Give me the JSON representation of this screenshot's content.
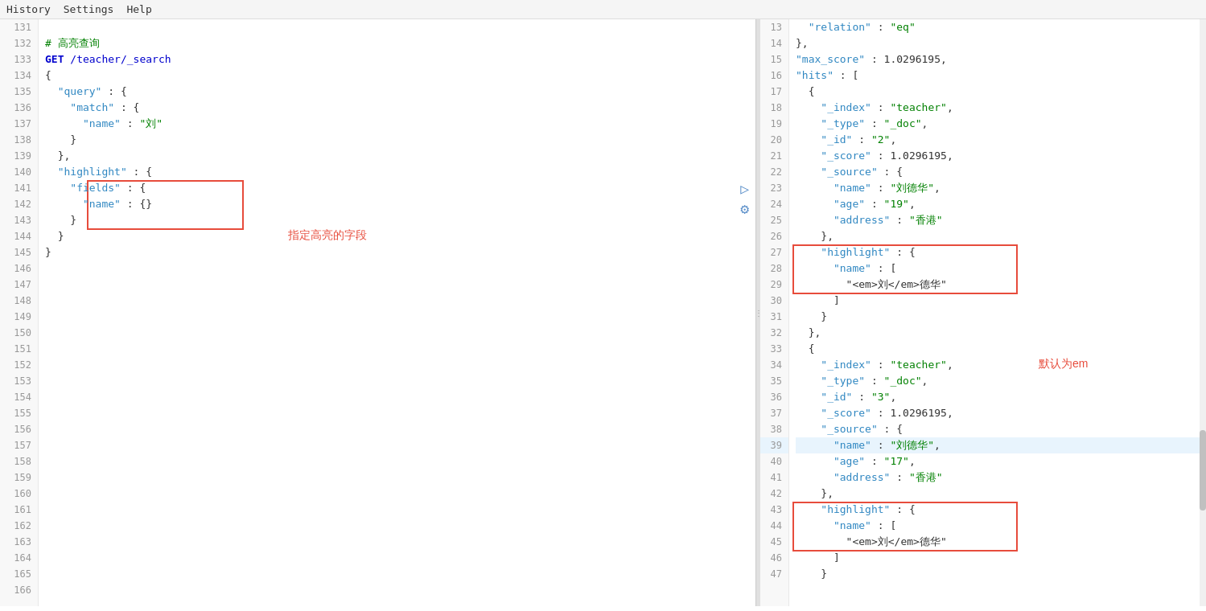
{
  "menu": {
    "items": [
      "History",
      "Settings",
      "Help"
    ]
  },
  "left_panel": {
    "lines": [
      {
        "num": 131,
        "content": "",
        "indent": 0
      },
      {
        "num": 132,
        "content": "# 高亮查询",
        "type": "comment"
      },
      {
        "num": 133,
        "content": "GET /teacher/_search",
        "type": "http"
      },
      {
        "num": 134,
        "content": "{",
        "fold": true
      },
      {
        "num": 135,
        "content": "  \"query\": {",
        "fold": true
      },
      {
        "num": 136,
        "content": "    \"match\": {",
        "fold": true
      },
      {
        "num": 137,
        "content": "      \"name\": \"刘\""
      },
      {
        "num": 138,
        "content": "    }"
      },
      {
        "num": 139,
        "content": "  },"
      },
      {
        "num": 140,
        "content": "  \"highlight\": {",
        "fold": true
      },
      {
        "num": 141,
        "content": "    \"fields\": {",
        "fold": true
      },
      {
        "num": 142,
        "content": "      \"name\": {}"
      },
      {
        "num": 143,
        "content": "    }"
      },
      {
        "num": 144,
        "content": "  }"
      },
      {
        "num": 145,
        "content": "}",
        "fold": true
      },
      {
        "num": 146,
        "content": ""
      },
      {
        "num": 147,
        "content": ""
      },
      {
        "num": 148,
        "content": ""
      },
      {
        "num": 149,
        "content": ""
      },
      {
        "num": 150,
        "content": ""
      },
      {
        "num": 151,
        "content": ""
      },
      {
        "num": 152,
        "content": ""
      },
      {
        "num": 153,
        "content": ""
      },
      {
        "num": 154,
        "content": ""
      },
      {
        "num": 155,
        "content": ""
      },
      {
        "num": 156,
        "content": ""
      },
      {
        "num": 157,
        "content": ""
      },
      {
        "num": 158,
        "content": ""
      },
      {
        "num": 159,
        "content": ""
      },
      {
        "num": 160,
        "content": ""
      },
      {
        "num": 161,
        "content": ""
      },
      {
        "num": 162,
        "content": ""
      },
      {
        "num": 163,
        "content": ""
      },
      {
        "num": 164,
        "content": ""
      },
      {
        "num": 165,
        "content": ""
      },
      {
        "num": 166,
        "content": ""
      }
    ],
    "annotation1": "指定高亮的字段",
    "annotation2": "默认为em"
  },
  "right_panel": {
    "lines": [
      {
        "num": 13,
        "content": "  \"relation\" : \"eq\""
      },
      {
        "num": 14,
        "content": "},",
        "fold": true
      },
      {
        "num": 15,
        "content": "\"max_score\" : 1.0296195,"
      },
      {
        "num": 16,
        "content": "\"hits\" : [",
        "fold": true
      },
      {
        "num": 17,
        "content": "  {",
        "fold": true
      },
      {
        "num": 18,
        "content": "    \"_index\" : \"teacher\","
      },
      {
        "num": 19,
        "content": "    \"_type\" : \"_doc\","
      },
      {
        "num": 20,
        "content": "    \"_id\" : \"2\","
      },
      {
        "num": 21,
        "content": "    \"_score\" : 1.0296195,"
      },
      {
        "num": 22,
        "content": "    \"_source\" : {",
        "fold": true
      },
      {
        "num": 23,
        "content": "      \"name\" : \"刘德华\","
      },
      {
        "num": 24,
        "content": "      \"age\" : \"19\","
      },
      {
        "num": 25,
        "content": "      \"address\" : \"香港\""
      },
      {
        "num": 26,
        "content": "    },"
      },
      {
        "num": 27,
        "content": "    \"highlight\" : {",
        "fold": true
      },
      {
        "num": 28,
        "content": "      \"name\" : ["
      },
      {
        "num": 29,
        "content": "        \"<em>刘</em>德华\""
      },
      {
        "num": 30,
        "content": "      ]"
      },
      {
        "num": 31,
        "content": "    }"
      },
      {
        "num": 32,
        "content": "  },"
      },
      {
        "num": 33,
        "content": "  {",
        "fold": true
      },
      {
        "num": 34,
        "content": "    \"_index\" : \"teacher\","
      },
      {
        "num": 35,
        "content": "    \"_type\" : \"_doc\","
      },
      {
        "num": 36,
        "content": "    \"_id\" : \"3\","
      },
      {
        "num": 37,
        "content": "    \"_score\" : 1.0296195,"
      },
      {
        "num": 38,
        "content": "    \"_source\" : {",
        "fold": true
      },
      {
        "num": 39,
        "content": "      \"name\" : \"刘德华\",",
        "highlighted": true
      },
      {
        "num": 40,
        "content": "      \"age\" : \"17\","
      },
      {
        "num": 41,
        "content": "      \"address\" : \"香港\""
      },
      {
        "num": 42,
        "content": "    },",
        "fold": true
      },
      {
        "num": 43,
        "content": "    \"highlight\" : {",
        "fold": true
      },
      {
        "num": 44,
        "content": "      \"name\" : [",
        "fold": true
      },
      {
        "num": 45,
        "content": "        \"<em>刘</em>德华\""
      },
      {
        "num": 46,
        "content": "      ]"
      },
      {
        "num": 47,
        "content": "    }"
      }
    ]
  }
}
